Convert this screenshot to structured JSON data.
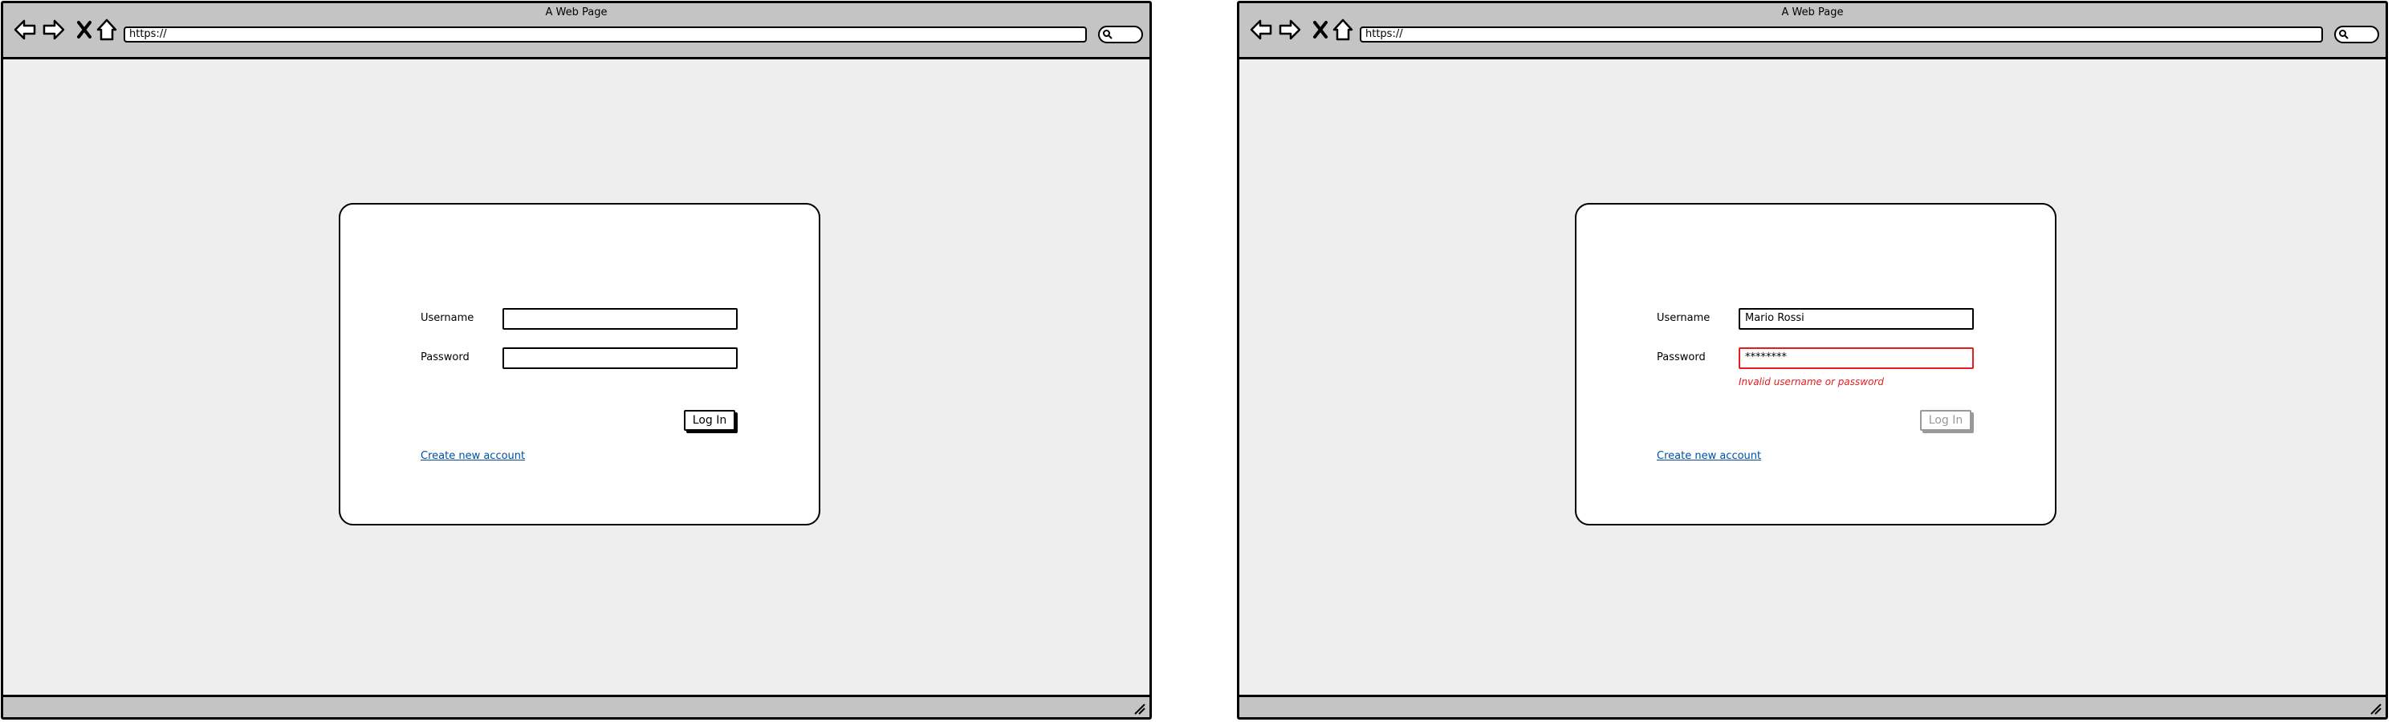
{
  "windows": [
    {
      "title": "A Web Page",
      "url": "https://",
      "login": {
        "username_label": "Username",
        "password_label": "Password",
        "username_value": "",
        "password_value": "",
        "error_message": "",
        "button_label": "Log In",
        "button_state": "enabled",
        "link_label": "Create new account"
      }
    },
    {
      "title": "A Web Page",
      "url": "https://",
      "login": {
        "username_label": "Username",
        "password_label": "Password",
        "username_value": "Mario Rossi",
        "password_value": "********",
        "error_message": "Invalid username or password",
        "button_label": "Log In",
        "button_state": "disabled",
        "link_label": "Create new account"
      }
    }
  ],
  "colors": {
    "chrome": "#c4c4c4",
    "page_background": "#eeeeee",
    "error": "#e41d1d",
    "link": "#0050a0"
  },
  "icons": [
    "back-arrow-icon",
    "forward-arrow-icon",
    "close-x-icon",
    "home-icon",
    "search-icon",
    "resize-grip-icon"
  ]
}
